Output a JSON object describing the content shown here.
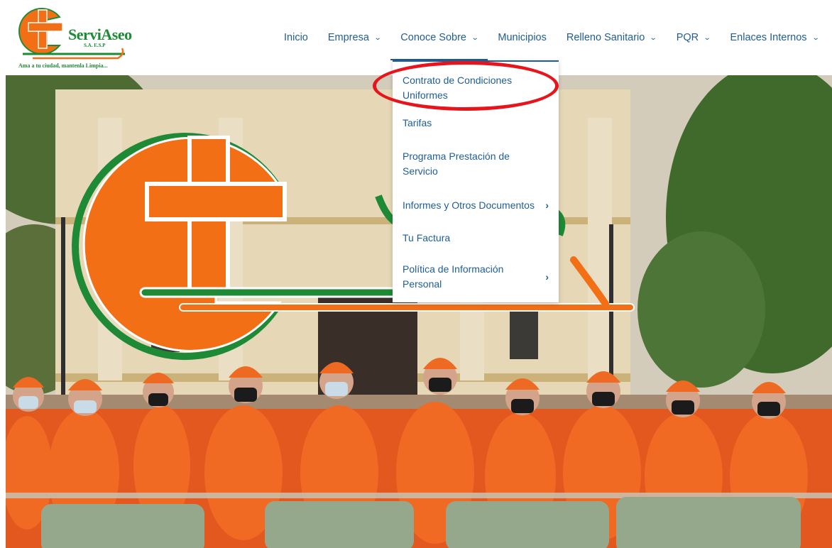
{
  "logo": {
    "name": "ServiAseo",
    "subtitle": "S.A. E.S.P",
    "tagline": "Ama a tu ciudad, mantenla Limpia..."
  },
  "nav": {
    "items": [
      {
        "label": "Inicio",
        "has_submenu": false
      },
      {
        "label": "Empresa",
        "has_submenu": true
      },
      {
        "label": "Conoce Sobre",
        "has_submenu": true,
        "active": true
      },
      {
        "label": "Municipios",
        "has_submenu": false
      },
      {
        "label": "Relleno Sanitario",
        "has_submenu": true
      },
      {
        "label": "PQR",
        "has_submenu": true
      },
      {
        "label": "Enlaces Internos",
        "has_submenu": true
      }
    ]
  },
  "dropdown": {
    "items": [
      {
        "label": "Contrato de Condiciones Uniformes",
        "has_submenu": false
      },
      {
        "label": "Tarifas",
        "has_submenu": false
      },
      {
        "label": "Programa Prestación de Servicio",
        "has_submenu": false
      },
      {
        "label": "Informes y Otros Documentos",
        "has_submenu": true
      },
      {
        "label": "Tu Factura",
        "has_submenu": false
      },
      {
        "label": "Política de Información Personal",
        "has_submenu": true
      }
    ]
  },
  "colors": {
    "link_blue": "#1f5d96",
    "brand_orange": "#f36f16",
    "brand_green": "#1e8a36",
    "annotation_red": "#e8141b"
  },
  "icons": {
    "chevron": "chevron-down-icon",
    "submenu_arrow": "chevron-right-icon"
  }
}
